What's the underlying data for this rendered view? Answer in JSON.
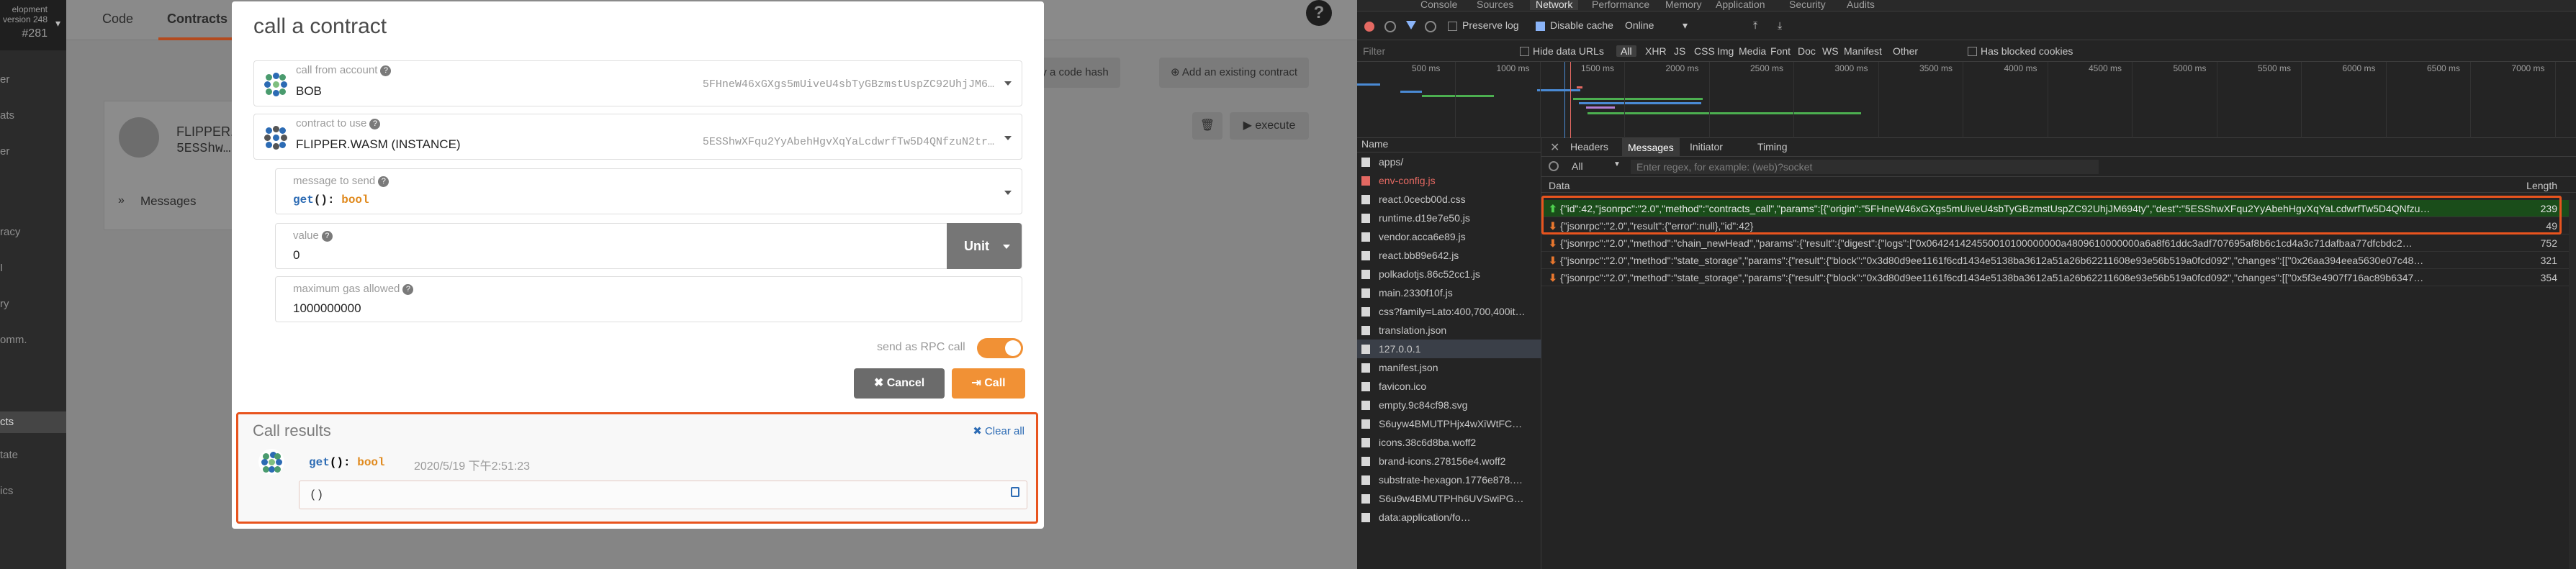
{
  "sidebar": {
    "header_line1": "elopment",
    "header_line2": "version 248",
    "header_line3": "#281",
    "items": [
      "er",
      "ats",
      "er",
      "",
      "racy",
      "I",
      "ry",
      "omm.",
      "",
      "cts",
      "tate",
      "ics"
    ],
    "active_index": 9
  },
  "app": {
    "tabs": [
      "Code",
      "Contracts"
    ],
    "active_tab": "Contracts",
    "deploy_button": "eploy a code hash",
    "add_existing_button": "Add an existing contract",
    "card": {
      "title": "FLIPPER.WA",
      "address": "5ESShw…t",
      "messages_label": "Messages"
    },
    "execute_button": "execute"
  },
  "modal": {
    "title": "call a contract",
    "call_from": {
      "label": "call from account",
      "value": "BOB",
      "address": "5FHneW46xGXgs5mUiveU4sbTyGBzmstUspZC92UhjJM6…"
    },
    "contract": {
      "label": "contract to use",
      "value": "FLIPPER.WASM (INSTANCE)",
      "address": "5ESShwXFqu2YyAbehHgvXqYaLcdwrfTw5D4QNfzuN2tr…"
    },
    "message": {
      "label": "message to send",
      "fn": "get",
      "sig_mid": "(): ",
      "type": "bool"
    },
    "value": {
      "label": "value",
      "amount": "0",
      "unit": "Unit"
    },
    "gas": {
      "label": "maximum gas allowed",
      "amount": "1000000000"
    },
    "rpc_label": "send as RPC call",
    "rpc_enabled": true,
    "cancel_label": "Cancel",
    "call_label": "Call",
    "results": {
      "title": "Call results",
      "clear_label": "Clear all",
      "entry_fn": "get",
      "entry_mid": "(): ",
      "entry_type": "bool",
      "timestamp": "2020/5/19 下午2:51:23",
      "output": "()"
    }
  },
  "devtools": {
    "tabs": [
      "Console",
      "Sources",
      "Network",
      "Performance",
      "Memory",
      "Application",
      "Security",
      "Audits"
    ],
    "active_tab": "Network",
    "preserve_log": "Preserve log",
    "disable_cache": "Disable cache",
    "throttle": "Online",
    "filter_placeholder": "Filter",
    "hide_data_urls": "Hide data URLs",
    "filter_types": [
      "All",
      "XHR",
      "JS",
      "CSS",
      "Img",
      "Media",
      "Font",
      "Doc",
      "WS",
      "Manifest",
      "Other"
    ],
    "selected_type": "All",
    "blocked_cookies": "Has blocked cookies",
    "timeline_ticks": [
      "500 ms",
      "1000 ms",
      "1500 ms",
      "2000 ms",
      "2500 ms",
      "3000 ms",
      "3500 ms",
      "4000 ms",
      "4500 ms",
      "5000 ms",
      "5500 ms",
      "6000 ms",
      "6500 ms",
      "7000 ms"
    ],
    "name_header": "Name",
    "requests": [
      "apps/",
      "env-config.js",
      "react.0cecb00d.css",
      "runtime.d19e7e50.js",
      "vendor.acca6e89.js",
      "react.bb89e642.js",
      "polkadotjs.86c52cc1.js",
      "main.2330f10f.js",
      "css?family=Lato:400,700,400it…",
      "translation.json",
      "127.0.0.1",
      "manifest.json",
      "favicon.ico",
      "empty.9c84cf98.svg",
      "S6uyw4BMUTPHjx4wXiWtFC…",
      "icons.38c6d8ba.woff2",
      "brand-icons.278156e4.woff2",
      "substrate-hexagon.1776e878.…",
      "S6u9w4BMUTPHh6UVSwiPG…",
      "data:application/fo…"
    ],
    "selected_request": 10,
    "error_request": 1,
    "detail_tabs": [
      "Headers",
      "Messages",
      "Initiator",
      "Timing"
    ],
    "active_detail_tab": "Messages",
    "msg_filter_all": "All",
    "regex_placeholder": "Enter regex, for example: (web)?socket",
    "data_header": "Data",
    "length_header": "Length",
    "frames": [
      {
        "dir": "sent",
        "text": "{\"id\":42,\"jsonrpc\":\"2.0\",\"method\":\"contracts_call\",\"params\":[{\"origin\":\"5FHneW46xGXgs5mUiveU4sbTyGBzmstUspZC92UhjJM694ty\",\"dest\":\"5ESShwXFqu2YyAbehHgvXqYaLcdwrfTw5D4QNfzu…",
        "len": "239"
      },
      {
        "dir": "recv",
        "text": "{\"jsonrpc\":\"2.0\",\"result\":{\"error\":null},\"id\":42}",
        "len": "49"
      },
      {
        "dir": "recv",
        "text": "{\"jsonrpc\":\"2.0\",\"method\":\"chain_newHead\",\"params\":{\"result\":{\"digest\":{\"logs\":[\"0x064241424550010100000000a4809610000000a6a8f61ddc3adf707695af8b6c1cd4a3c71dafbaa77dfcbdc2…",
        "len": "752"
      },
      {
        "dir": "recv",
        "text": "{\"jsonrpc\":\"2.0\",\"method\":\"state_storage\",\"params\":{\"result\":{\"block\":\"0x3d80d9ee1161f6cd1434e5138ba3612a51a26b62211608e93e56b519a0fcd092\",\"changes\":[[\"0x26aa394eea5630e07c48…",
        "len": "321"
      },
      {
        "dir": "recv",
        "text": "{\"jsonrpc\":\"2.0\",\"method\":\"state_storage\",\"params\":{\"result\":{\"block\":\"0x3d80d9ee1161f6cd1434e5138ba3612a51a26b62211608e93e56b519a0fcd092\",\"changes\":[[\"0x5f3e4907f716ac89b6347…",
        "len": "354"
      }
    ]
  }
}
